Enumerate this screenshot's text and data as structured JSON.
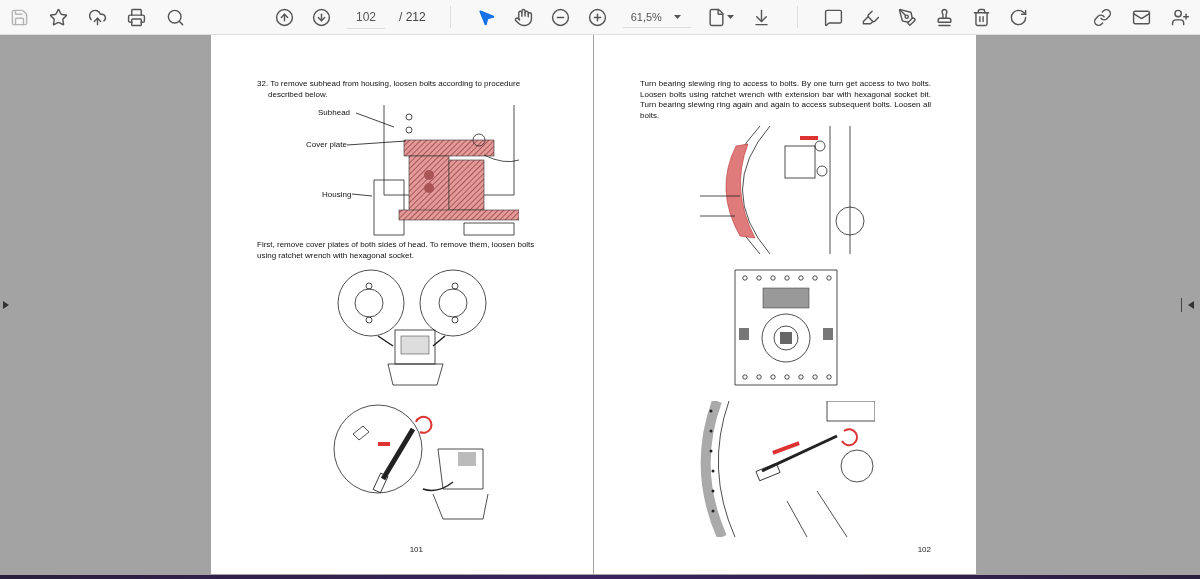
{
  "toolbar": {
    "save": {
      "disabled": true
    },
    "page_number": "102",
    "page_total": "/ 212",
    "modes": [
      {
        "selected": true
      },
      {
        "selected": false
      }
    ],
    "zoom": "61,5%"
  },
  "pages": [
    {
      "blocks": [
        {
          "kind": "text",
          "text": "32. To remove subhead from housing, loosen bolts according to procedure described below.",
          "numbered": true
        },
        {
          "kind": "subhead",
          "callouts": [
            "Subhead",
            "Cover plate",
            "Housing"
          ]
        },
        {
          "kind": "text",
          "text": "First, remove cover plates of both sides of head. To remove them, loosen bolts using ratchet wrench with hexagonal socket."
        },
        {
          "kind": "plates"
        },
        {
          "kind": "wrench"
        }
      ],
      "page_number": "101"
    },
    {
      "blocks": [
        {
          "kind": "text",
          "text": "Turn bearing slewing ring to access to bolts. By one turn get access to two bolts. Loosen bolts using ratchet wrench with extension bar with hexagonal socket bit. Turn bearing slewing ring again and again to access subsequent bolts. Loosen all bolts.",
          "justify": true
        },
        {
          "kind": "ring"
        },
        {
          "kind": "head"
        },
        {
          "kind": "ratchet"
        }
      ],
      "page_number": "102"
    }
  ]
}
